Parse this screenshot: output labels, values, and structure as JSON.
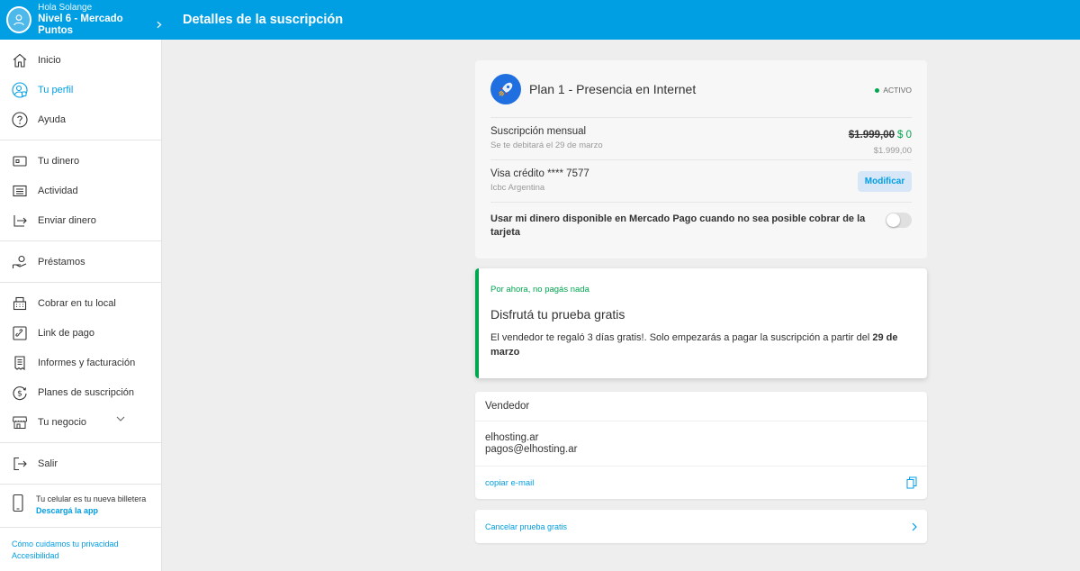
{
  "header": {
    "greeting": "Hola Solange",
    "level": "Nivel 6 - Mercado Puntos",
    "page_title": "Detalles de la suscripción",
    "brand_color": "#009ee3"
  },
  "sidebar": {
    "groups": [
      [
        {
          "label": "Inicio",
          "icon": "home-icon"
        },
        {
          "label": "Tu perfil",
          "icon": "profile-icon",
          "active": true
        },
        {
          "label": "Ayuda",
          "icon": "help-icon"
        }
      ],
      [
        {
          "label": "Tu dinero",
          "icon": "wallet-icon"
        },
        {
          "label": "Actividad",
          "icon": "activity-icon"
        },
        {
          "label": "Enviar dinero",
          "icon": "send-money-icon"
        }
      ],
      [
        {
          "label": "Préstamos",
          "icon": "loan-icon"
        }
      ],
      [
        {
          "label": "Cobrar en tu local",
          "icon": "cash-register-icon"
        },
        {
          "label": "Link de pago",
          "icon": "payment-link-icon"
        },
        {
          "label": "Informes y facturación",
          "icon": "invoice-icon"
        },
        {
          "label": "Planes de suscripción",
          "icon": "subscription-plans-icon"
        },
        {
          "label": "Tu negocio",
          "icon": "store-icon"
        }
      ],
      [
        {
          "label": "Salir",
          "icon": "logout-icon"
        }
      ]
    ],
    "promo_text": "Tu celular es tu nueva billetera",
    "promo_link": "Descargá la app",
    "footer_links": [
      "Cómo cuidamos tu privacidad",
      "Accesibilidad"
    ]
  },
  "plan": {
    "name": "Plan 1 - Presencia en Internet",
    "status": "ACTIVO",
    "subscription_label": "Suscripción mensual",
    "billing_note": "Se te debitará el 29 de marzo",
    "price_old": "$1.999,00",
    "price_new": "$ 0",
    "price_full": "$1.999,00",
    "card_label": "Visa crédito **** 7577",
    "card_bank": "Icbc Argentina",
    "modify_label": "Modificar",
    "toggle_label": "Usar mi dinero disponible en Mercado Pago cuando no sea posible cobrar de la tarjeta",
    "toggle_on": false,
    "status_color": "#00a650"
  },
  "trial": {
    "tag": "Por ahora, no pagás nada",
    "title": "Disfrutá tu prueba gratis",
    "desc_before": "El vendedor te regaló 3 días gratis!. Solo empezarás a pagar la suscripción a partir del ",
    "desc_bold": "29 de marzo"
  },
  "seller": {
    "title": "Vendedor",
    "name": "elhosting.ar",
    "email": "pagos@elhosting.ar",
    "copy_label": "copiar e-mail"
  },
  "cancel": {
    "label": "Cancelar prueba gratis"
  }
}
